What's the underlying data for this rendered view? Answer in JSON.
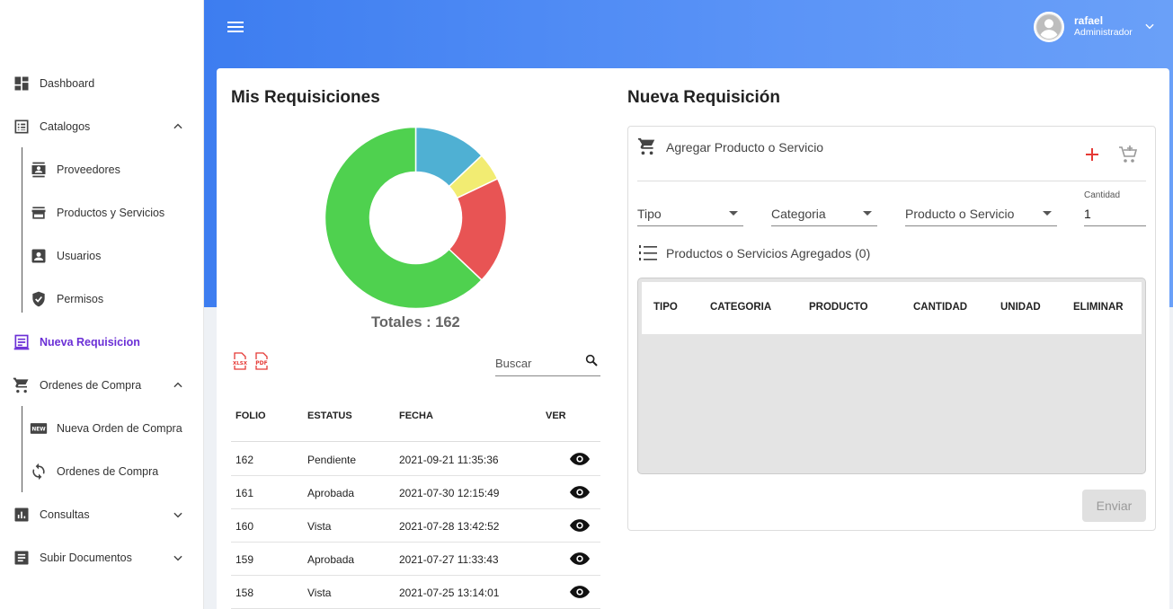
{
  "header": {
    "user_name": "rafael",
    "user_role": "Administrador"
  },
  "sidebar": {
    "items": [
      {
        "label": "Dashboard",
        "icon": "dashboard-icon"
      },
      {
        "label": "Catalogos",
        "icon": "list-icon",
        "expanded": true
      },
      {
        "label": "Proveedores",
        "icon": "contact-card-icon"
      },
      {
        "label": "Productos y Servicios",
        "icon": "store-icon"
      },
      {
        "label": "Usuarios",
        "icon": "user-box-icon"
      },
      {
        "label": "Permisos",
        "icon": "shield-check-icon"
      },
      {
        "label": "Nueva Requisicion",
        "icon": "form-icon",
        "active": true
      },
      {
        "label": "Ordenes de Compra",
        "icon": "cart-icon",
        "expanded": true
      },
      {
        "label": "Nueva Orden de Compra",
        "icon": "new-badge-icon"
      },
      {
        "label": "Ordenes de Compra",
        "icon": "sync-icon"
      },
      {
        "label": "Consultas",
        "icon": "bar-chart-icon",
        "expanded": false
      },
      {
        "label": "Subir Documentos",
        "icon": "document-icon",
        "expanded": false
      }
    ]
  },
  "requisiciones": {
    "title": "Mis Requisiciones",
    "totals_label": "Totales : 162",
    "search_placeholder": "Buscar",
    "export_icons": [
      "xlsx-icon",
      "pdf-icon"
    ],
    "columns": [
      "FOLIO",
      "ESTATUS",
      "FECHA",
      "VER"
    ],
    "rows": [
      {
        "folio": "162",
        "estatus": "Pendiente",
        "fecha": "2021-09-21 11:35:36"
      },
      {
        "folio": "161",
        "estatus": "Aprobada",
        "fecha": "2021-07-30 12:15:49"
      },
      {
        "folio": "160",
        "estatus": "Vista",
        "fecha": "2021-07-28 13:42:52"
      },
      {
        "folio": "159",
        "estatus": "Aprobada",
        "fecha": "2021-07-27 11:33:43"
      },
      {
        "folio": "158",
        "estatus": "Vista",
        "fecha": "2021-07-25 13:14:01"
      }
    ]
  },
  "chart_data": {
    "type": "pie",
    "donut": true,
    "slices": [
      {
        "value": 21,
        "color": "#4fb0d3"
      },
      {
        "value": 8,
        "color": "#f2ec72"
      },
      {
        "value": 31,
        "color": "#e85454"
      },
      {
        "value": 102,
        "color": "#4fd14f"
      }
    ],
    "total": 162
  },
  "nueva": {
    "title": "Nueva Requisición",
    "add_title": "Agregar Producto o Servicio",
    "tipo": "Tipo",
    "categoria": "Categoria",
    "producto": "Producto o Servicio",
    "cantidad_label": "Cantidad",
    "cantidad_value": "1",
    "list_title": "Productos o Servicios Agregados (0)",
    "columns": [
      "TIPO",
      "CATEGORIA",
      "PRODUCTO",
      "CANTIDAD",
      "UNIDAD",
      "ELIMINAR"
    ],
    "send_label": "Enviar",
    "accent_color": "#e53935"
  }
}
